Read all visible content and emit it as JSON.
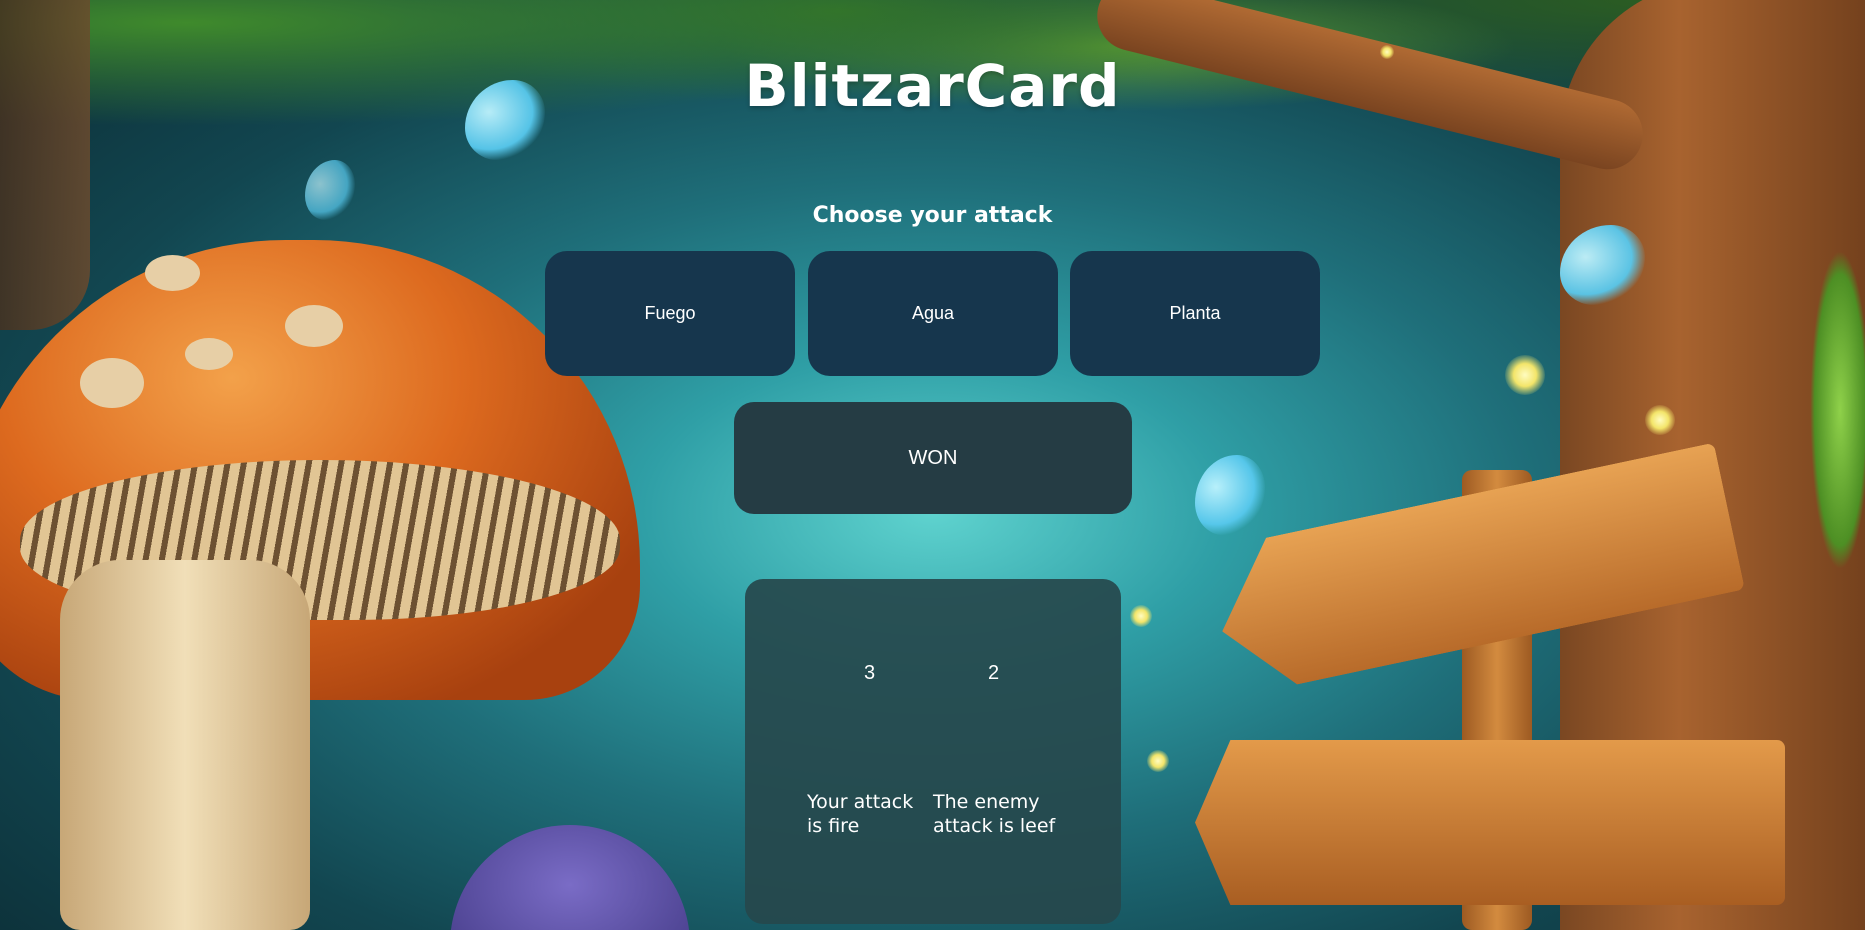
{
  "app": {
    "title": "BlitzarCard",
    "subtitle": "Choose your attack"
  },
  "attacks": [
    {
      "label": "Fuego"
    },
    {
      "label": "Agua"
    },
    {
      "label": "Planta"
    }
  ],
  "result": {
    "text": "WON"
  },
  "scoreboard": {
    "player_score": "3",
    "enemy_score": "2",
    "player_message": "Your attack is fire",
    "enemy_message": "The enemy attack is leef"
  },
  "colors": {
    "attack_button_bg": "#16364d",
    "result_box_bg": "#253c44",
    "panel_bg": "#26484c",
    "text": "#ffffff"
  },
  "icons": {
    "butterfly": "butterfly-icon",
    "firefly": "firefly-glow"
  }
}
